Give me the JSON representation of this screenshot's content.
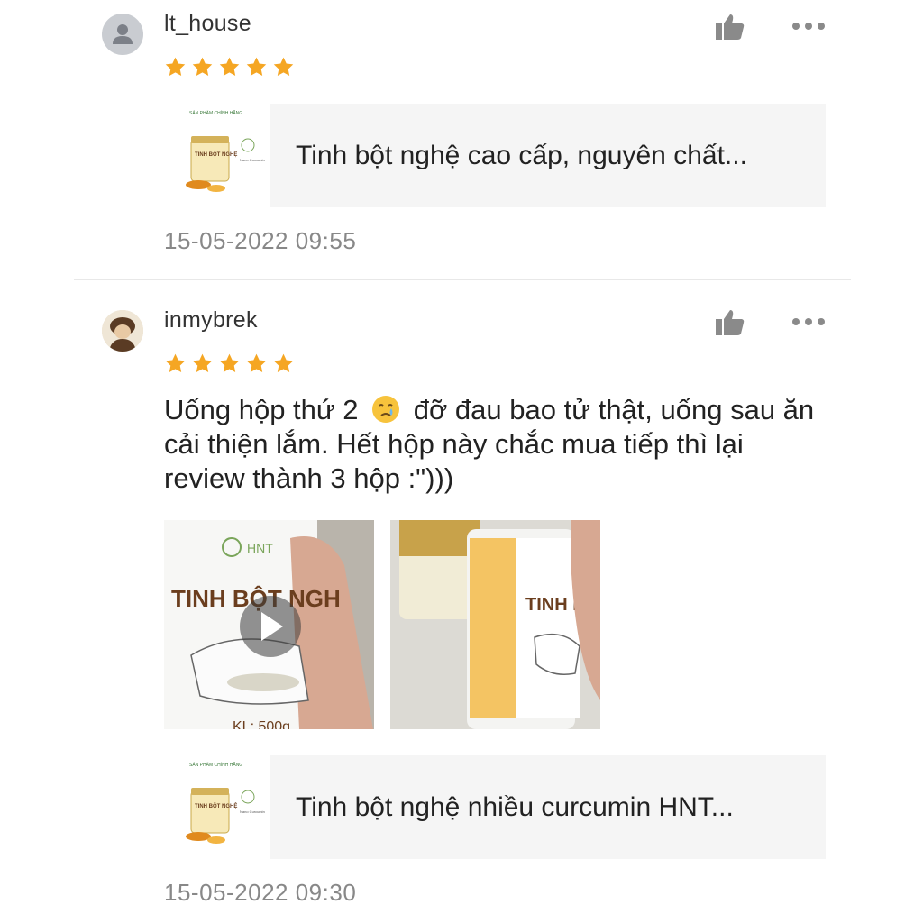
{
  "reviews": [
    {
      "username": "lt_house",
      "rating": 5,
      "product": {
        "name": "Tinh bột nghệ cao cấp, nguyên chất...",
        "thumb_label": "TINH BỘT NGHỆ"
      },
      "timestamp": "15-05-2022 09:55"
    },
    {
      "username": "inmybrek",
      "rating": 5,
      "comment_parts": [
        "Uống hộp thứ 2 ",
        " đỡ đau bao tử thật, uống sau ăn cải thiện lắm. Hết hộp này chắc mua tiếp thì lại review thành 3 hộp :\")))"
      ],
      "media": [
        {
          "type": "video",
          "label": "TINH BỘT NGH",
          "brand": "HNT",
          "weight": "KL: 500g"
        },
        {
          "type": "image",
          "label": "TINH BỘ"
        }
      ],
      "product": {
        "name": "Tinh bột nghệ nhiều curcumin HNT...",
        "thumb_label": "TINH BỘT NGHỆ"
      },
      "timestamp": "15-05-2022 09:30"
    }
  ],
  "colors": {
    "star": "#f5a623",
    "accent": "#ee4d2d",
    "muted": "#888888"
  },
  "icons": [
    "user-icon",
    "star-icon",
    "thumbs-up-icon",
    "more-icon",
    "play-icon",
    "crying-face-emoji"
  ]
}
